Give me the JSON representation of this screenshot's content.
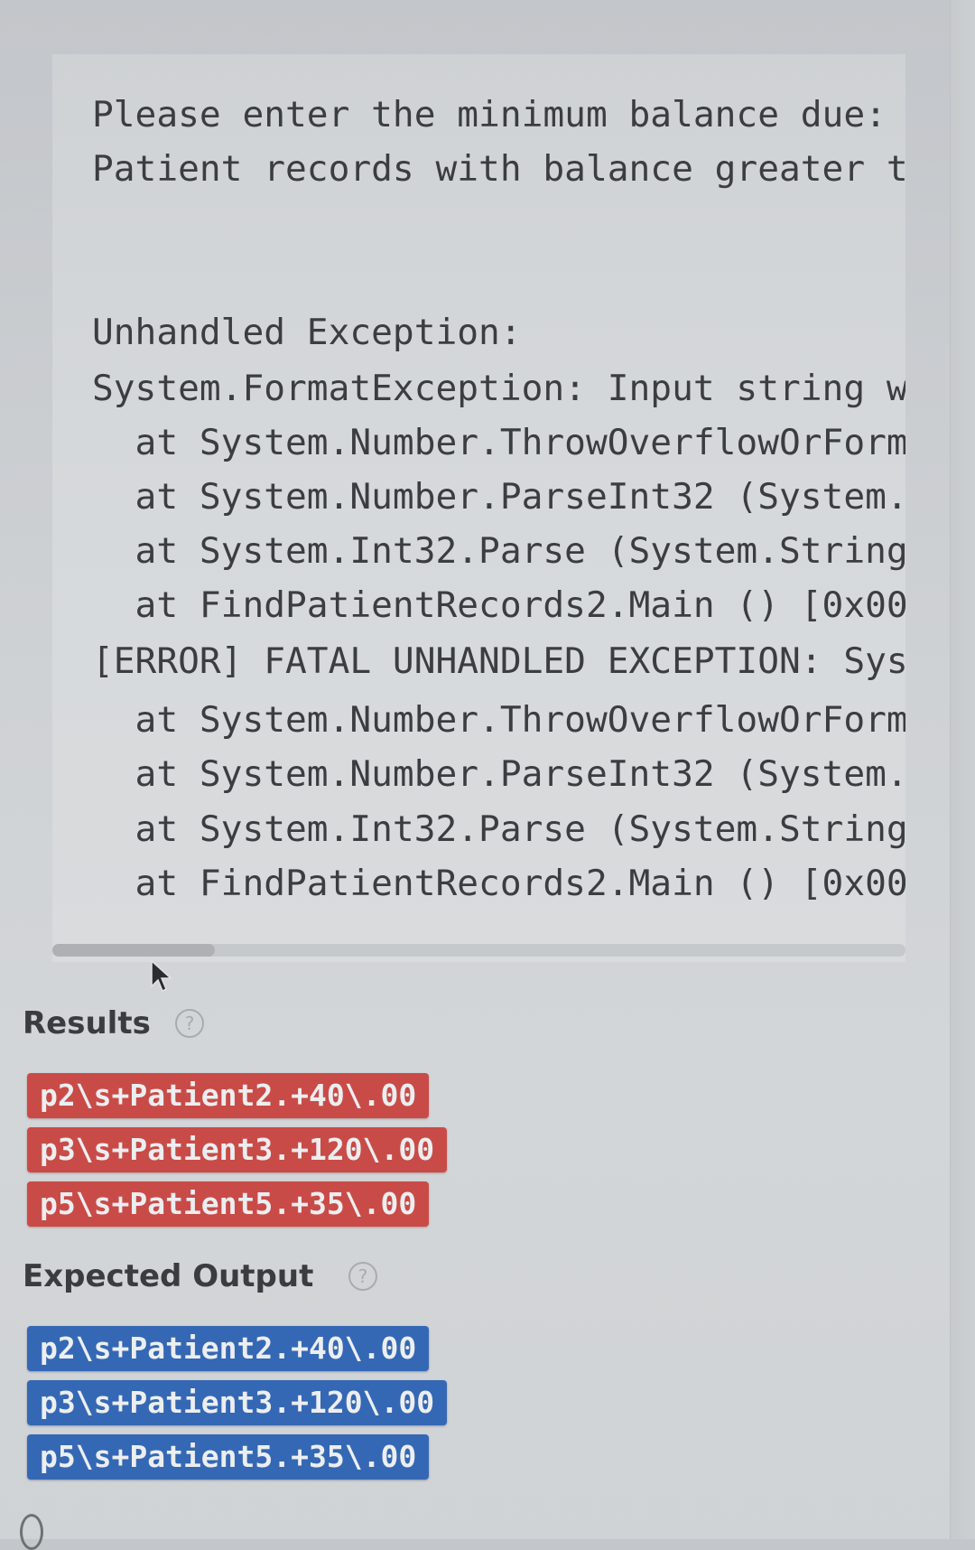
{
  "console": {
    "lines": [
      "Please enter the minimum balance due:",
      "Patient records with balance greater t",
      "",
      "",
      "Unhandled Exception:",
      "System.FormatException: Input string w",
      "  at System.Number.ThrowOverflowOrForm",
      "  at System.Number.ParseInt32 (System.",
      "  at System.Int32.Parse (System.String",
      "  at FindPatientRecords2.Main () [0x00",
      "[ERROR] FATAL UNHANDLED EXCEPTION: Sys",
      "  at System.Number.ThrowOverflowOrForm",
      "  at System.Number.ParseInt32 (System.",
      "  at System.Int32.Parse (System.String",
      "  at FindPatientRecords2.Main () [0x00"
    ],
    "scroll_position_fraction": 0.0,
    "visible_fraction": 0.19
  },
  "results": {
    "title": "Results",
    "help_icon": "question-circle-icon",
    "items": [
      "p2\\s+Patient2.+40\\.00",
      "p3\\s+Patient3.+120\\.00",
      "p5\\s+Patient5.+35\\.00"
    ],
    "status": "fail",
    "color": "#c94b47"
  },
  "expected_output": {
    "title": "Expected Output",
    "help_icon": "question-circle-icon",
    "items": [
      "p2\\s+Patient2.+40\\.00",
      "p3\\s+Patient3.+120\\.00",
      "p5\\s+Patient5.+35\\.00"
    ],
    "color": "#3568b4"
  }
}
